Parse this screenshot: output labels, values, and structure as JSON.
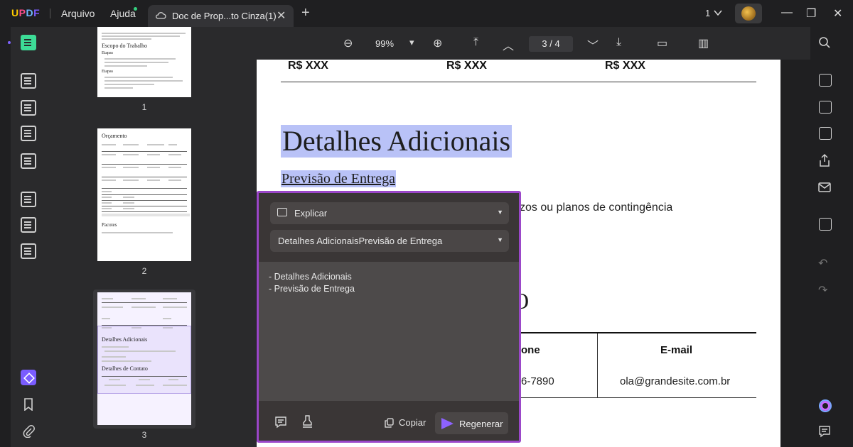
{
  "app": {
    "logo": "UPDF",
    "menu": {
      "arquivo": "Arquivo",
      "ajuda": "Ajuda"
    },
    "tab_title": "Doc de Prop...to Cinza(1)",
    "tab_close": "✕",
    "tab_add": "+",
    "page_selector": "1",
    "window_buttons": {
      "minimize": "—",
      "maximize": "❐",
      "close": "✕"
    }
  },
  "toolbar": {
    "zoom_out": "⊖",
    "zoom_value": "99%",
    "zoom_dropdown": "▾",
    "zoom_in": "⊕",
    "first_page": "⤒",
    "prev_page": "︿",
    "current_page": "3",
    "page_sep": "/",
    "total_pages": "4",
    "next_page": "﹀",
    "last_page": "⤓",
    "present": "▭",
    "reading_mode": "▥"
  },
  "thumbnails": {
    "pages": [
      {
        "label": "1",
        "heading": "Escopo do Trabalho",
        "sub1": "Etapas",
        "sub2": "Etapas"
      },
      {
        "label": "2",
        "heading": "Orçamento",
        "heading2": "Pacotes"
      },
      {
        "label": "3",
        "heading": "Detalhes Adicionais",
        "heading2": "Detalhes de Contato"
      }
    ]
  },
  "document": {
    "prices": [
      "R$ XXX",
      "R$ XXX",
      "R$ XXX"
    ],
    "heading": "Detalhes Adicionais",
    "subheading": "Previsão de Entrega",
    "partial_text": "zos ou planos de contingência",
    "partial_heading": "O",
    "contact_headers": {
      "phone": "one",
      "email": "E-mail"
    },
    "contact_values": {
      "phone": "6-7890",
      "email": "ola@grandesite.com.br"
    }
  },
  "ai_panel": {
    "mode": "Explicar",
    "context": "Detalhes AdicionaisPrevisão de Entrega",
    "result_lines": [
      "- Detalhes Adicionais",
      "- Previsão de Entrega"
    ],
    "copy_label": "Copiar",
    "regenerate_label": "Regenerar"
  },
  "colors": {
    "accent": "#8d62ff",
    "panel_border": "#9b47c9",
    "highlight": "#b9c2f7",
    "active_tool": "#3ddc97"
  }
}
